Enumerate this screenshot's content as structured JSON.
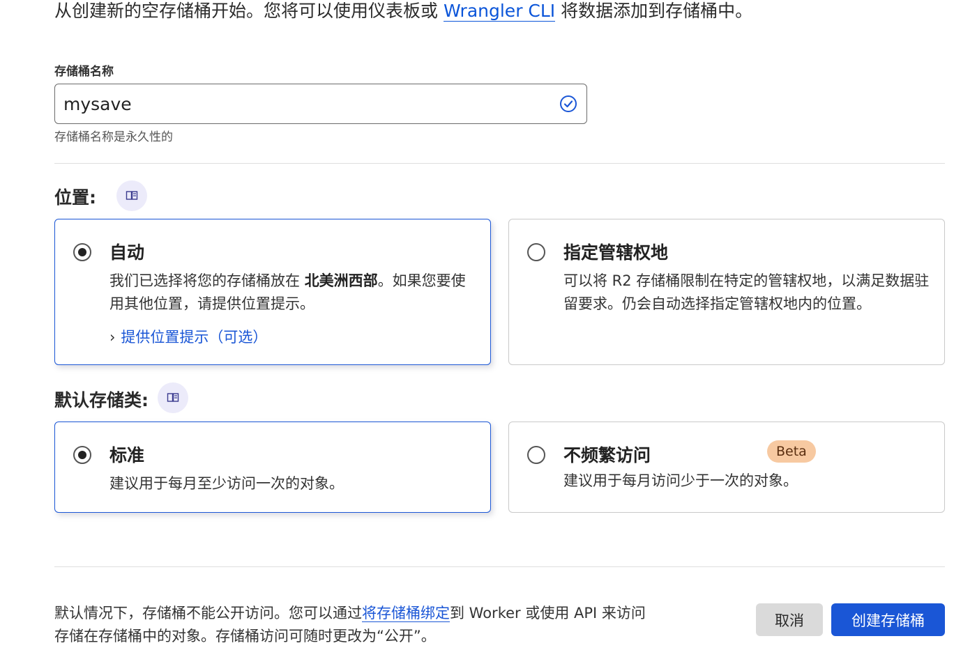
{
  "intro": {
    "prefix": "从创建新的空存储桶开始。您将可以使用仪表板或 ",
    "link": "Wrangler CLI",
    "suffix": " 将数据添加到存储桶中。"
  },
  "bucket_name": {
    "label": "存储桶名称",
    "value": "mysave",
    "help": "存储桶名称是永久性的",
    "valid_icon": "check-circle-icon"
  },
  "location": {
    "title": "位置:",
    "doc_icon": "book-icon",
    "options": [
      {
        "title": "自动",
        "selected": true,
        "desc_before": "我们已选择将您的存储桶放在 ",
        "desc_bold": "北美洲西部",
        "desc_after": "。如果您要使用其他位置，请提供位置提示。",
        "hint_link": "提供位置提示（可选）"
      },
      {
        "title": "指定管辖权地",
        "selected": false,
        "desc": "可以将 R2 存储桶限制在特定的管辖权地，以满足数据驻留要求。仍会自动选择指定管辖权地内的位置。"
      }
    ]
  },
  "storage_class": {
    "title": "默认存储类:",
    "doc_icon": "book-icon",
    "options": [
      {
        "title": "标准",
        "selected": true,
        "desc": "建议用于每月至少访问一次的对象。"
      },
      {
        "title": "不频繁访问",
        "selected": false,
        "badge": "Beta",
        "desc": "建议用于每月访问少于一次的对象。"
      }
    ]
  },
  "footer": {
    "note_before": "默认情况下，存储桶不能公开访问。您可以通过",
    "note_link": "将存储桶绑定",
    "note_after": "到 Worker 或使用 API 来访问存储在存储桶中的对象。存储桶访问可随时更改为“公开”。",
    "cancel_label": "取消",
    "create_label": "创建存储桶"
  },
  "colors": {
    "accent": "#1a56d6",
    "beta_badge": "#f7c9a1",
    "doc_badge": "#ecebfa"
  }
}
